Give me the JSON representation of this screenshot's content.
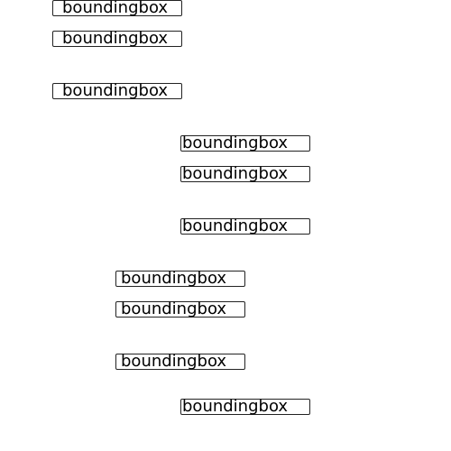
{
  "boxes": [
    {
      "label": "boundingbox"
    },
    {
      "label": "boundingbox"
    },
    {
      "label": "boundingbox"
    },
    {
      "label": "boundingbox"
    },
    {
      "label": "boundingbox"
    },
    {
      "label": "boundingbox"
    },
    {
      "label": "boundingbox"
    },
    {
      "label": "boundingbox"
    },
    {
      "label": "boundingbox"
    },
    {
      "label": "boundingbox"
    }
  ]
}
